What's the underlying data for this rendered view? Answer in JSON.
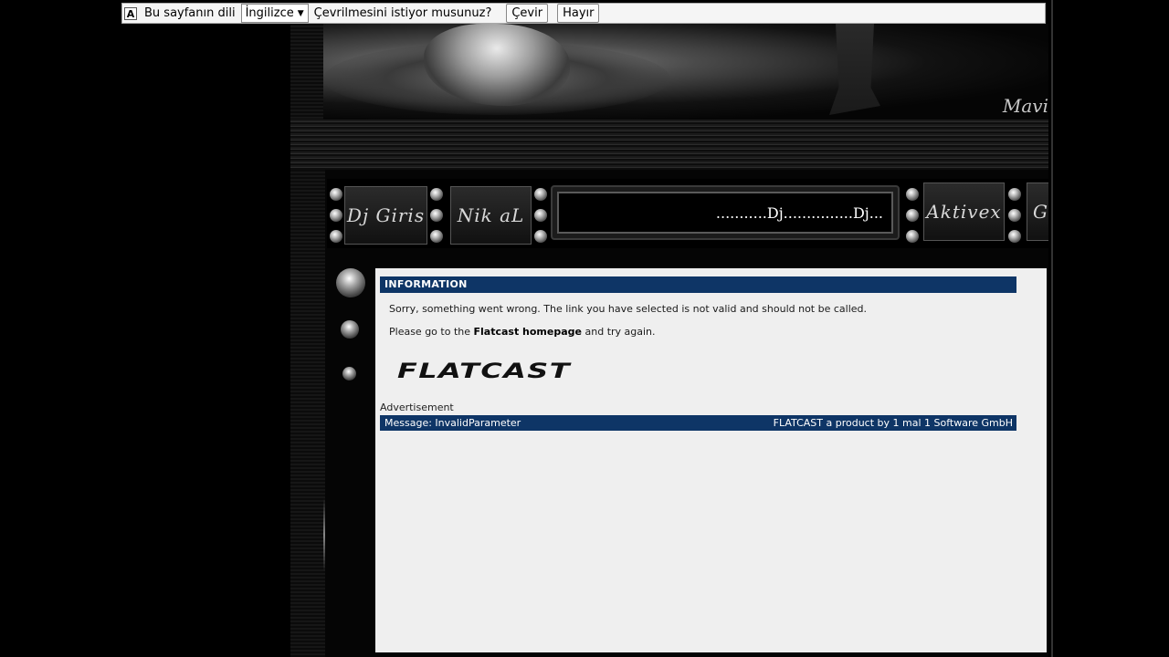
{
  "translate_bar": {
    "icon": "translate-icon",
    "icon_glyph": "A",
    "prompt": "Bu sayfanın dili",
    "language": "İngilizce",
    "question": "Çevrilmesini istiyor musunuz?",
    "translate_button": "Çevir",
    "no_button": "Hayır"
  },
  "banner": {
    "signature": "Mavi"
  },
  "nav": {
    "items": [
      {
        "label": "Dj Giris"
      },
      {
        "label": "Nik aL"
      },
      {
        "label": "Aktivex"
      },
      {
        "label": "G"
      }
    ],
    "marquee": "...........Dj...............Dj..."
  },
  "info": {
    "header": "INFORMATION",
    "line1": "Sorry, something went wrong. The link you have selected is not valid and should not be called.",
    "line2_prefix": "Please go to the ",
    "line2_link": "Flatcast homepage",
    "line2_suffix": " and try again.",
    "logo": "FLATCAST",
    "advertisement": "Advertisement",
    "footer_left": "Message: InvalidParameter",
    "footer_right": "FLATCAST a product by 1 mal 1 Software GmbH"
  },
  "colors": {
    "header_bg": "#0e3566",
    "content_bg": "#efefef",
    "site_bg": "#000000"
  }
}
